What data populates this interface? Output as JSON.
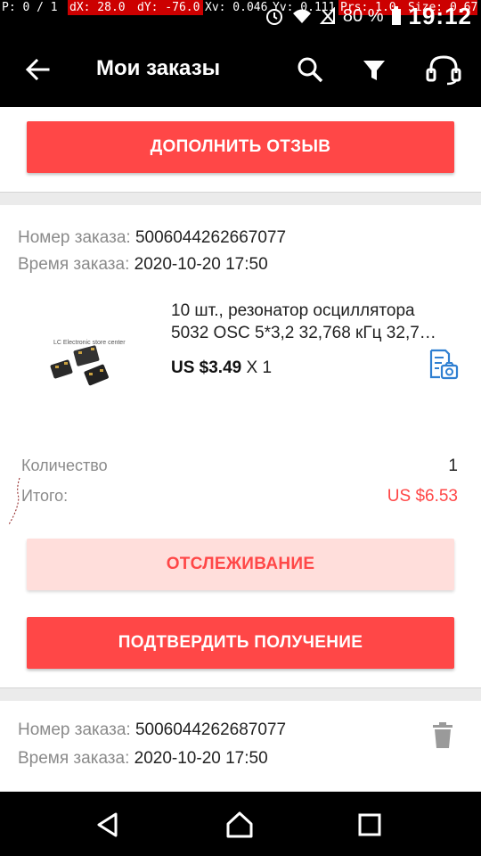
{
  "debug": {
    "p": "P: 0 / 1",
    "dx": "dX: 28.0",
    "dy": "dY: -76.0",
    "xv": "Xv: 0.046",
    "yv": "Yv: 0.111",
    "prs": "Prs: 1.0",
    "size": "Size: 0.67"
  },
  "status": {
    "battery": "80 %",
    "time": "19:12"
  },
  "header": {
    "title": "Мои заказы",
    "icons": [
      "back-arrow-icon",
      "search-icon",
      "filter-icon",
      "support-headset-icon"
    ]
  },
  "card1": {
    "button": "ДОПОЛНИТЬ ОТЗЫВ"
  },
  "order1": {
    "number_label": "Номер заказа:",
    "number": "5006044262667077",
    "time_label": "Время заказа:",
    "time": "2020-10-20 17:50",
    "product": {
      "title_line1": "10 шт., резонатор осциллятора",
      "title_line2": "5032 OSC 5*3,2 32,768 кГц 32,7…",
      "image_caption": "LC Electronic store center",
      "price": "US $3.49",
      "qty": "X 1"
    },
    "quantity_label": "Количество",
    "quantity": "1",
    "total_label": "Итого:",
    "total": "US $6.53",
    "track_button": "ОТСЛЕЖИВАНИЕ",
    "confirm_button": "ПОДТВЕРДИТЬ ПОЛУЧЕНИЕ"
  },
  "order2": {
    "number_label": "Номер заказа:",
    "number": "5006044262687077",
    "time_label": "Время заказа:",
    "time": "2020-10-20 17:50"
  },
  "colors": {
    "accent": "#ff4747",
    "accent_light": "#ffdedb",
    "link_blue": "#2f7fd1"
  },
  "navbar": {
    "icons": [
      "nav-back-icon",
      "nav-home-icon",
      "nav-recents-icon"
    ]
  }
}
